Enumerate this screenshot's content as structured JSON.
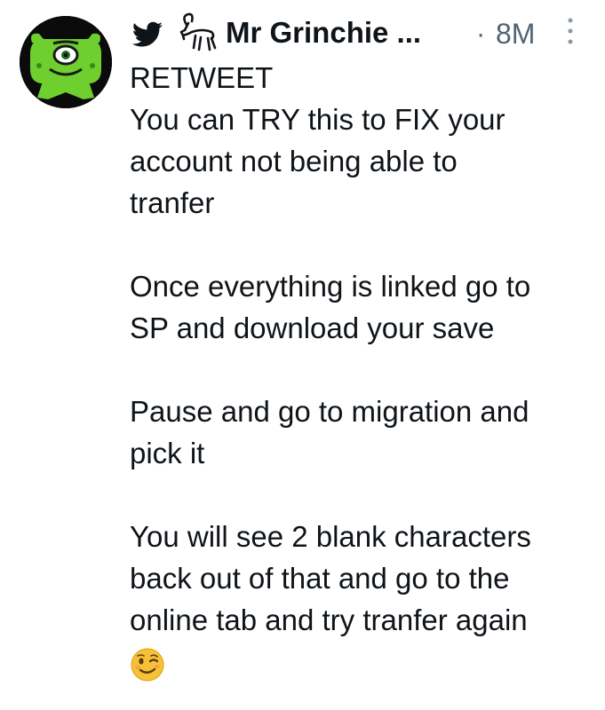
{
  "tweet": {
    "author": {
      "display_name": "Mr Grinchie ...",
      "avatar_icon": "green-alien-avatar",
      "badges": [
        "bird-icon",
        "goat-icon"
      ]
    },
    "separator": "·",
    "timestamp": "8M",
    "more_icon": "vertical-ellipsis-icon",
    "paragraphs": [
      [
        "RETWEET",
        "You can TRY this to FIX your",
        "account not being able to",
        "tranfer"
      ],
      [
        "Once everything is linked go to",
        "SP and download your save"
      ],
      [
        "Pause and go to migration and",
        "pick it"
      ],
      [
        "You will see 2 blank characters",
        "back out of that and go to the",
        "online tab and try tranfer again"
      ]
    ],
    "trailing_emoji": "winking-face-emoji"
  },
  "colors": {
    "text_primary": "#0f1419",
    "text_secondary": "#536471",
    "avatar_green": "#6fcf2f",
    "avatar_bg": "#0b0b0b",
    "emoji_yellow": "#f7c137"
  }
}
